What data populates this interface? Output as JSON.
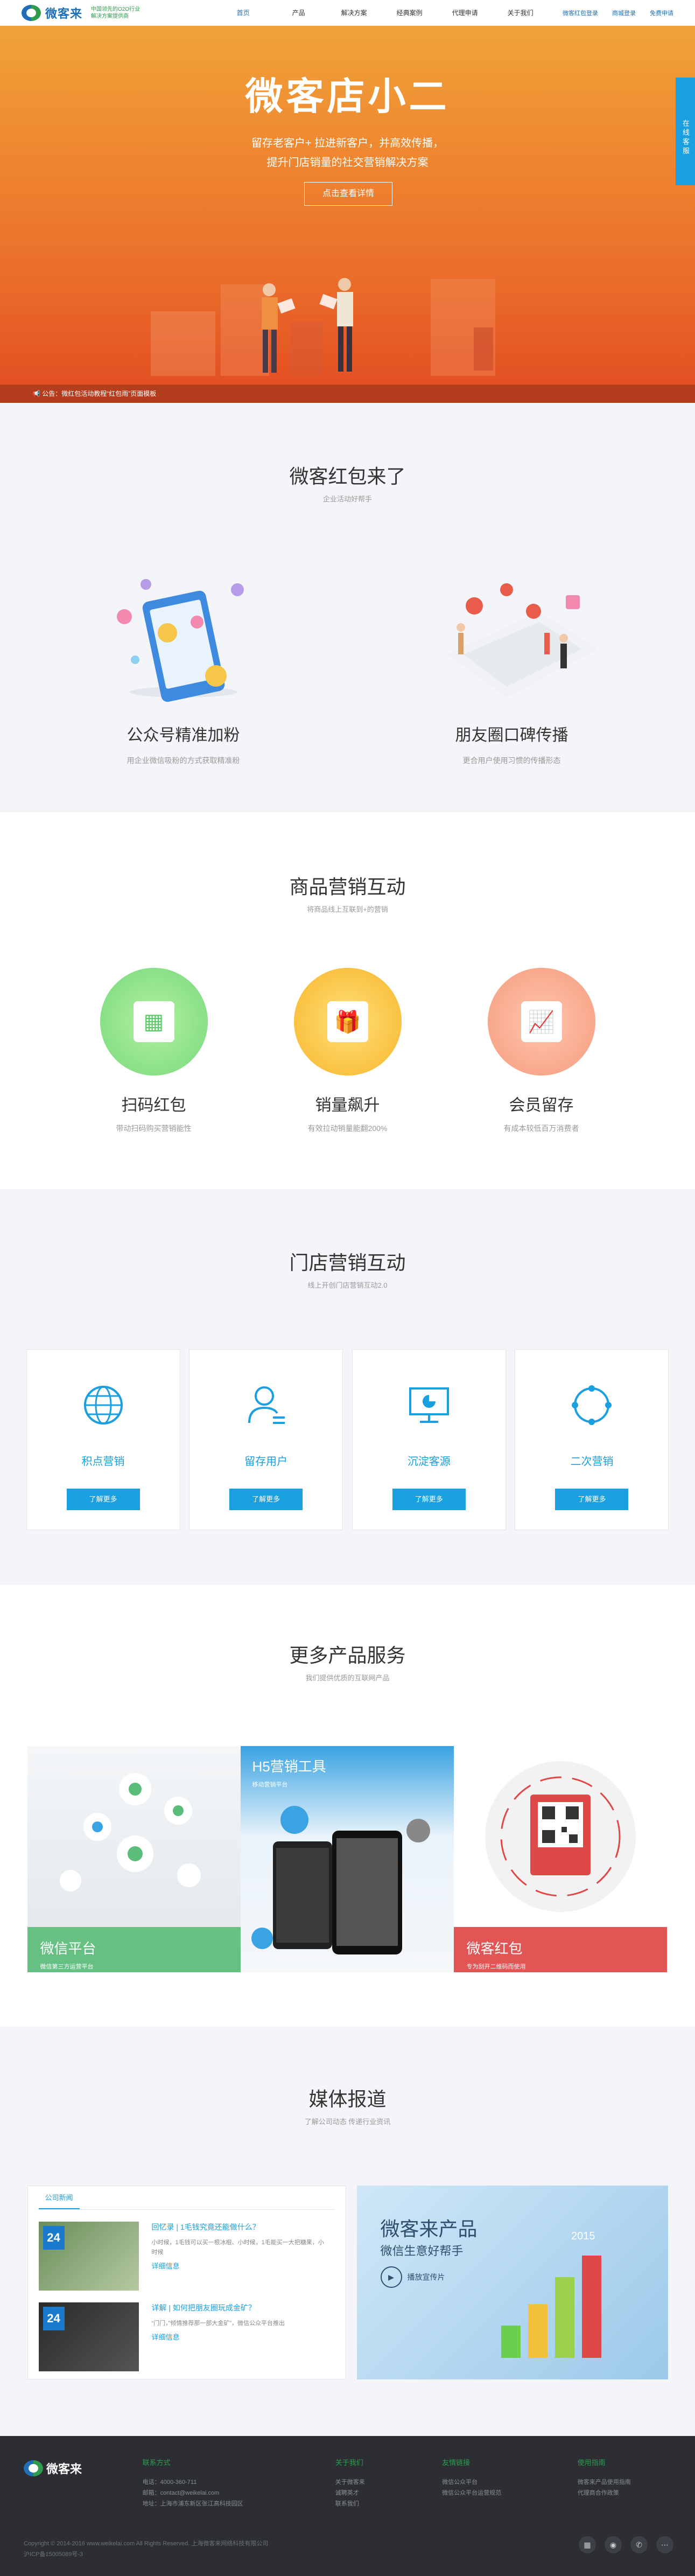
{
  "header": {
    "logo_text": "微客来",
    "slogan_line1": "中国领先的O2O行业",
    "slogan_line2": "解决方案提供商",
    "nav": [
      "首页",
      "产品",
      "解决方案",
      "经典案例",
      "代理申请",
      "关于我们"
    ],
    "nav_right": [
      "微客红包登录",
      "商城登录",
      "免费申请"
    ]
  },
  "hero": {
    "title": "微客店小二",
    "sub_line1": "留存老客户+ 拉进新客户，并高效传播，",
    "sub_line2": "提升门店销量的社交营销解决方案",
    "button": "点击查看详情",
    "notice": "公告：微红包活动教程“红包雨”页面模板",
    "side_tab": "在线客服"
  },
  "s1": {
    "title": "微客红包来了",
    "sub": "企业活动好帮手",
    "items": [
      {
        "label": "公众号精准加粉",
        "desc": "用企业微信吸粉的方式获取精准粉"
      },
      {
        "label": "朋友圈口碑传播",
        "desc": "更合用户使用习惯的传播形态"
      }
    ]
  },
  "s2": {
    "title": "商品营销互动",
    "sub": "将商品线上互联到+的营销",
    "items": [
      {
        "label": "扫码红包",
        "desc": "带动扫码购买营销能性"
      },
      {
        "label": "销量飙升",
        "desc": "有效拉动销量能翻200%"
      },
      {
        "label": "会员留存",
        "desc": "有成本较低百万消费者"
      }
    ]
  },
  "s3": {
    "title": "门店营销互动",
    "sub": "线上开创门店营销互动2.0",
    "cards": [
      {
        "label": "积点营销",
        "button": "了解更多",
        "icon": "globe-icon"
      },
      {
        "label": "留存用户",
        "button": "了解更多",
        "icon": "user-icon"
      },
      {
        "label": "沉淀客源",
        "button": "了解更多",
        "icon": "monitor-chart-icon"
      },
      {
        "label": "二次营销",
        "button": "了解更多",
        "icon": "cycle-icon"
      }
    ]
  },
  "s4": {
    "title": "更多产品服务",
    "sub": "我们提供优质的互联网产品",
    "cards": [
      {
        "title": "微信平台",
        "sub": "微信第三方运营平台",
        "color": "#5bbd7a"
      },
      {
        "title": "H5营销工具",
        "sub": "移动营销平台",
        "color": "#3aa3e3"
      },
      {
        "title": "微客红包",
        "sub": "专为刮开二维码而使用",
        "color": "#e04747"
      }
    ]
  },
  "s5": {
    "title": "媒体报道",
    "sub": "了解公司动态 传递行业资讯",
    "news_tab": "公司新闻",
    "news": [
      {
        "date": "24",
        "title": "回忆录 | 1毛钱究竟还能做什么？",
        "text": "小时候，1毛钱可以买一根冰棍、小时候，1毛能买一大把糖果，小时候",
        "more": "详细信息"
      },
      {
        "date": "24",
        "title": "详解 | 如何把朋友圈玩成金矿？",
        "text": "“门门，”倾情推荐那一部大金矿”，微信公众平台推出",
        "more": "详细信息"
      }
    ],
    "promo_title": "微客来产品",
    "promo_sub": "微信生意好帮手",
    "promo_play": "播放宣传片"
  },
  "footer": {
    "logo_text": "微客来",
    "cols": [
      {
        "head": "联系方式",
        "lines": [
          "电话：4000-360-711",
          "邮箱：contact@weikelai.com",
          "地址：上海市浦东新区张江高科技园区"
        ]
      },
      {
        "head": "关于我们",
        "lines": [
          "关于微客来",
          "诚聘英才",
          "联系我们"
        ]
      },
      {
        "head": "友情链接",
        "lines": [
          "微信公众平台",
          "微信公众平台运营规范"
        ]
      },
      {
        "head": "使用指南",
        "lines": [
          "微客来产品使用指南",
          "代理商合作政策"
        ]
      }
    ],
    "copyright": "Copyright © 2014-2016 www.weikelai.com All Rights Reserved. 上海微客来网络科技有限公司",
    "icp": "沪ICP备15005089号-3"
  }
}
